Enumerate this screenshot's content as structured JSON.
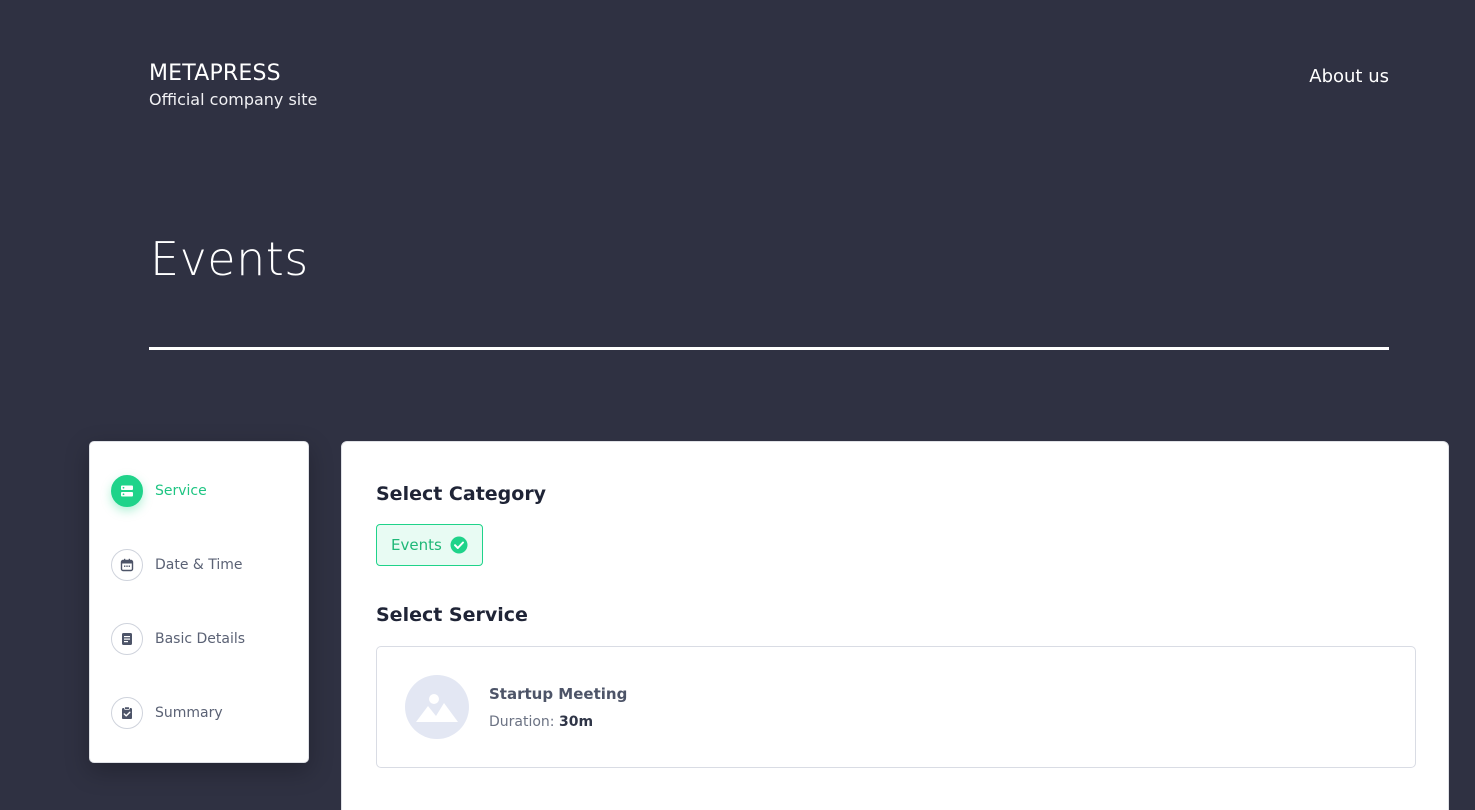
{
  "header": {
    "brand_name": "METAPRESS",
    "brand_tagline": "Official company site",
    "nav_about": "About us"
  },
  "page": {
    "title": "Events"
  },
  "steps": [
    {
      "label": "Service",
      "icon": "server-icon",
      "active": true
    },
    {
      "label": "Date & Time",
      "icon": "calendar-icon",
      "active": false
    },
    {
      "label": "Basic Details",
      "icon": "document-icon",
      "active": false
    },
    {
      "label": "Summary",
      "icon": "clipboard-check-icon",
      "active": false
    }
  ],
  "main": {
    "category_heading": "Select Category",
    "category_selected": "Events",
    "service_heading": "Select Service",
    "service": {
      "name": "Startup Meeting",
      "duration_label": "Duration:",
      "duration_value": "30m",
      "thumb_icon": "image-placeholder-icon"
    }
  },
  "colors": {
    "background": "#2f3142",
    "accent": "#1fd38a"
  }
}
